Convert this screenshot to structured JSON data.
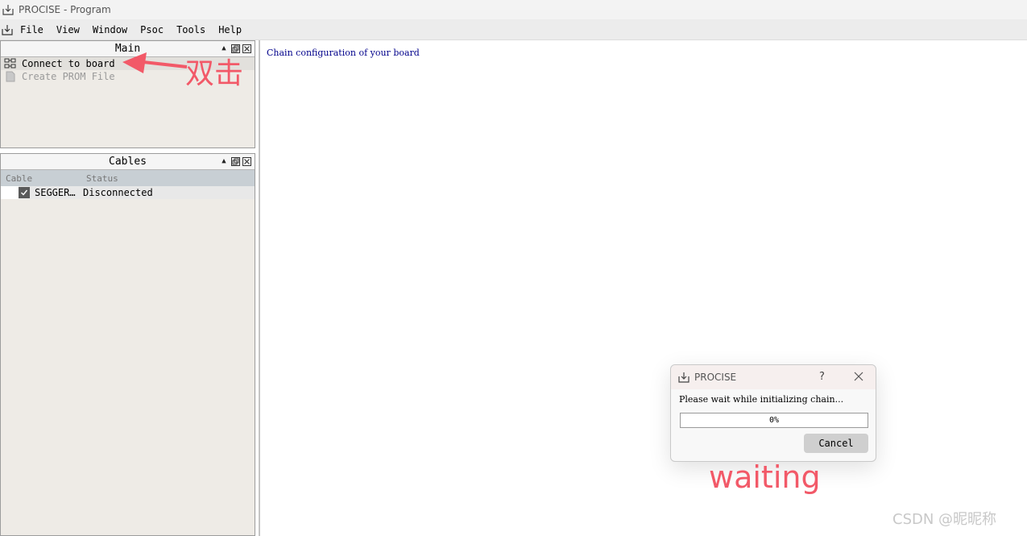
{
  "window": {
    "title": "PROCISE - Program"
  },
  "menu": {
    "items": [
      "File",
      "View",
      "Window",
      "Psoc",
      "Tools",
      "Help"
    ]
  },
  "main_panel": {
    "title": "Main",
    "items": [
      {
        "label": "Connect to board",
        "icon": "board-icon",
        "enabled": true
      },
      {
        "label": "Create PROM File",
        "icon": "document-icon",
        "enabled": false
      }
    ]
  },
  "cables_panel": {
    "title": "Cables",
    "columns": [
      "Cable",
      "Status"
    ],
    "rows": [
      {
        "cable": "SEGGER…",
        "status": "Disconnected",
        "checked": true
      }
    ]
  },
  "content": {
    "heading": "Chain configuration of your board"
  },
  "dialog": {
    "title": "PROCISE",
    "help": "?",
    "message": "Please wait while initializing chain...",
    "progress_label": "0%",
    "progress_value": 0,
    "cancel_label": "Cancel"
  },
  "annotations": {
    "double_click_note": "双击",
    "waiting_note": "waiting",
    "color": "#f25968"
  },
  "watermark": "CSDN @昵昵称"
}
